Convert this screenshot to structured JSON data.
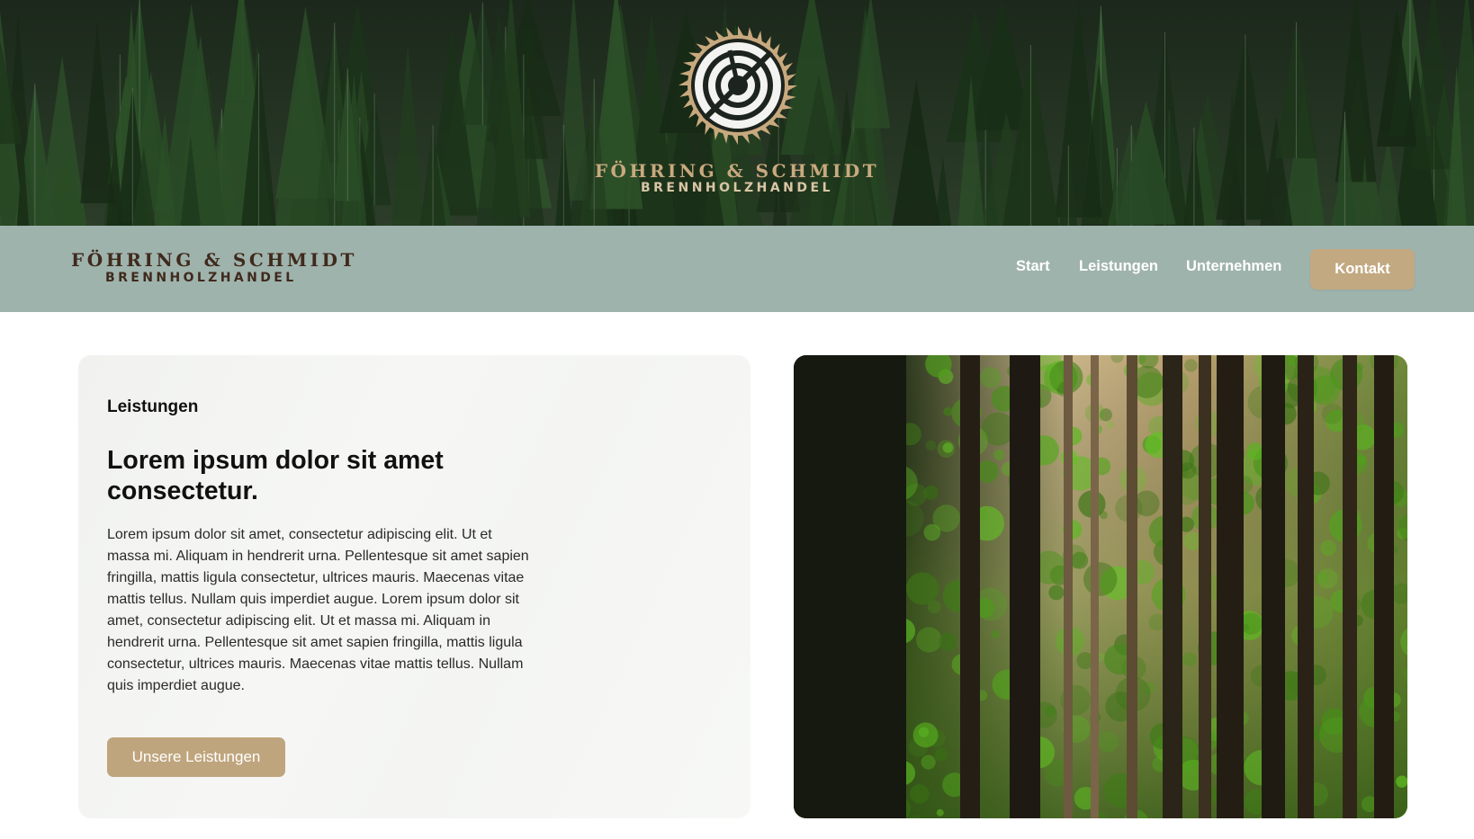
{
  "hero": {
    "brand_name": "FÖHRING & SCHMIDT",
    "brand_sub": "BRENNHOLZHANDEL",
    "emblem_icon": "saw-blade-logo-icon"
  },
  "nav": {
    "brand_name": "FÖHRING & SCHMIDT",
    "brand_sub": "BRENNHOLZHANDEL",
    "links": [
      {
        "label": "Start"
      },
      {
        "label": "Leistungen"
      },
      {
        "label": "Unternehmen"
      }
    ],
    "cta_label": "Kontakt"
  },
  "content": {
    "eyebrow": "Leistungen",
    "title": "Lorem ipsum dolor sit amet consectetur.",
    "body": "Lorem ipsum dolor sit amet, consectetur adipiscing elit. Ut et massa mi. Aliquam in hendrerit urna. Pellentesque sit amet sapien fringilla, mattis ligula consectetur, ultrices mauris. Maecenas vitae mattis tellus. Nullam quis imperdiet augue. Lorem ipsum dolor sit amet, consectetur adipiscing elit. Ut et massa mi. Aliquam in hendrerit urna. Pellentesque sit amet sapien fringilla, mattis ligula consectetur, ultrices mauris. Maecenas vitae mattis tellus. Nullam quis imperdiet augue.",
    "button_label": "Unsere Leistungen"
  },
  "colors": {
    "nav_bg": "#9fb3ad",
    "accent_gold": "#c2a981",
    "brand_brown": "#3f2a1c",
    "card_bg": "#f4f5f3"
  }
}
